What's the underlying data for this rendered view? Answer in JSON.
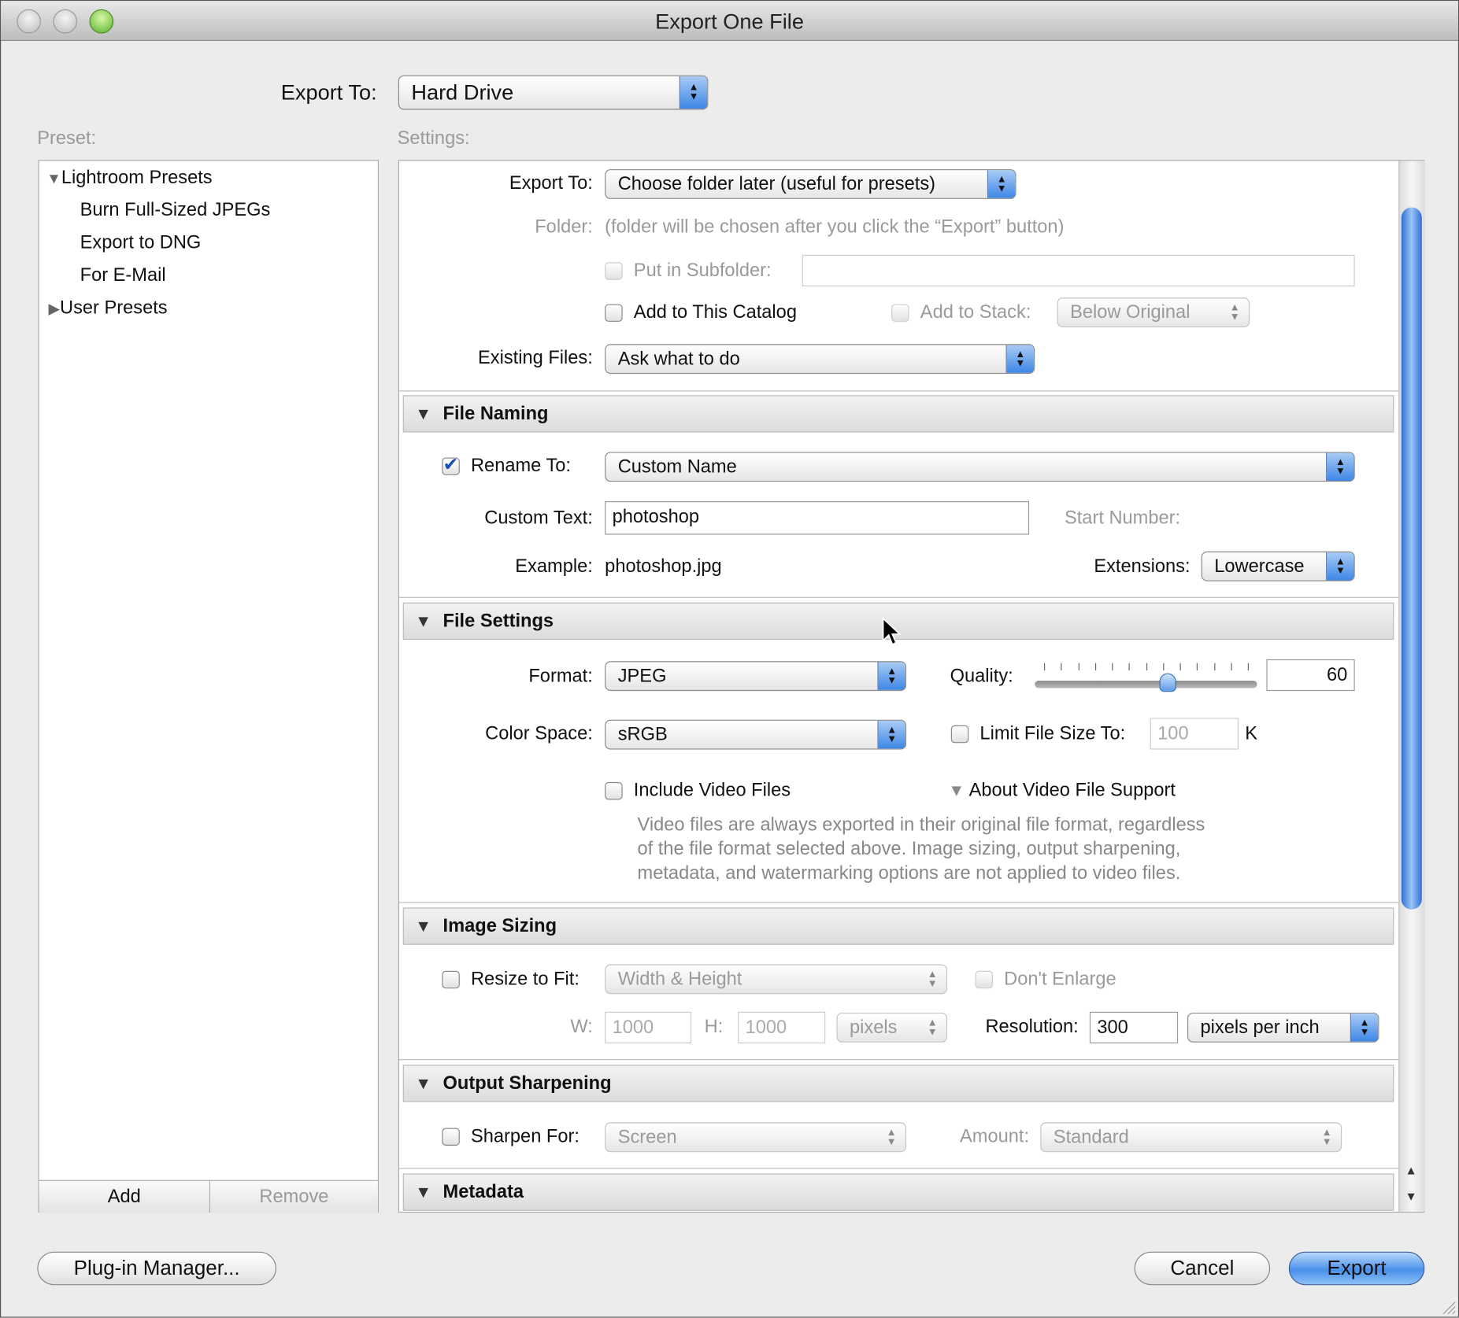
{
  "window": {
    "title": "Export One File"
  },
  "top": {
    "export_to_label": "Export To:",
    "export_to_value": "Hard Drive"
  },
  "preset": {
    "label": "Preset:",
    "items": [
      "Lightroom Presets",
      "Burn Full-Sized JPEGs",
      "Export to DNG",
      "For E-Mail",
      "User Presets"
    ],
    "add": "Add",
    "remove": "Remove"
  },
  "settings": {
    "label": "Settings:",
    "location": {
      "export_to_label": "Export To:",
      "export_to_value": "Choose folder later (useful for presets)",
      "folder_label": "Folder:",
      "folder_text": "(folder will be chosen after you click the “Export” button)",
      "subfolder_label": "Put in Subfolder:",
      "subfolder_value": "",
      "add_catalog_label": "Add to This Catalog",
      "add_stack_label": "Add to Stack:",
      "stack_value": "Below Original",
      "existing_label": "Existing Files:",
      "existing_value": "Ask what to do"
    },
    "file_naming": {
      "header": "File Naming",
      "rename_label": "Rename To:",
      "rename_checked": true,
      "rename_value": "Custom Name",
      "custom_text_label": "Custom Text:",
      "custom_text_value": "photoshop",
      "start_number_label": "Start Number:",
      "example_label": "Example:",
      "example_value": "photoshop.jpg",
      "extensions_label": "Extensions:",
      "extensions_value": "Lowercase"
    },
    "file_settings": {
      "header": "File Settings",
      "format_label": "Format:",
      "format_value": "JPEG",
      "quality_label": "Quality:",
      "quality_value": "60",
      "quality_percent": 60,
      "color_space_label": "Color Space:",
      "color_space_value": "sRGB",
      "limit_label": "Limit File Size To:",
      "limit_value": "100",
      "limit_unit": "K",
      "video_label": "Include Video Files",
      "about_video": "About Video File Support",
      "video_note": [
        "Video files are always exported in their original file format, regardless",
        "of the file format selected above. Image sizing, output sharpening,",
        "metadata, and watermarking options are not applied to video files."
      ]
    },
    "image_sizing": {
      "header": "Image Sizing",
      "resize_label": "Resize to Fit:",
      "resize_value": "Width & Height",
      "dont_enlarge": "Don't Enlarge",
      "w_label": "W:",
      "w_value": "1000",
      "h_label": "H:",
      "h_value": "1000",
      "unit_value": "pixels",
      "resolution_label": "Resolution:",
      "resolution_value": "300",
      "resolution_unit": "pixels per inch"
    },
    "output_sharpening": {
      "header": "Output Sharpening",
      "sharpen_label": "Sharpen For:",
      "sharpen_value": "Screen",
      "amount_label": "Amount:",
      "amount_value": "Standard"
    },
    "metadata": {
      "header": "Metadata"
    }
  },
  "footer": {
    "plugin_manager": "Plug-in Manager...",
    "cancel": "Cancel",
    "export": "Export"
  },
  "colors": {
    "accent": "#3d86e6"
  }
}
